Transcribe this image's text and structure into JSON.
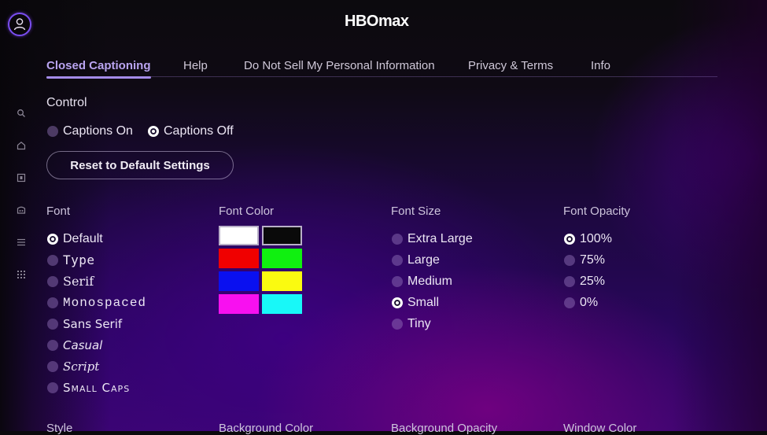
{
  "header": {
    "logo": "HBOmax",
    "profile_icon": "profile-icon"
  },
  "sidebar": {
    "icons": [
      "search-icon",
      "home-icon",
      "watchlist-icon",
      "kids-icon",
      "menu-icon",
      "grid-icon"
    ]
  },
  "tabs": [
    {
      "label": "Closed Captioning",
      "active": true
    },
    {
      "label": "Help",
      "active": false
    },
    {
      "label": "Do Not Sell My Personal Information",
      "active": false
    },
    {
      "label": "Privacy & Terms",
      "active": false
    },
    {
      "label": "Info",
      "active": false
    }
  ],
  "control": {
    "title": "Control",
    "options": [
      {
        "label": "Captions On",
        "selected": false
      },
      {
        "label": "Captions Off",
        "selected": true
      }
    ],
    "reset_label": "Reset to Default Settings"
  },
  "font": {
    "title": "Font",
    "options": [
      {
        "label": "Default",
        "selected": true
      },
      {
        "label": "Type",
        "selected": false
      },
      {
        "label": "Serif",
        "selected": false
      },
      {
        "label": "Monospaced",
        "selected": false
      },
      {
        "label": "Sans Serif",
        "selected": false
      },
      {
        "label": "Casual",
        "selected": false
      },
      {
        "label": "Script",
        "selected": false
      },
      {
        "label": "Small Caps",
        "selected": false
      }
    ]
  },
  "font_color": {
    "title": "Font Color",
    "swatches": [
      {
        "name": "white",
        "color": "#ffffff",
        "selected": true
      },
      {
        "name": "black",
        "color": "#0a0a0a",
        "selected": true
      },
      {
        "name": "red",
        "color": "#f00000",
        "selected": false
      },
      {
        "name": "green",
        "color": "#10f010",
        "selected": false
      },
      {
        "name": "blue",
        "color": "#0a10f0",
        "selected": false
      },
      {
        "name": "yellow",
        "color": "#fafa10",
        "selected": false
      },
      {
        "name": "magenta",
        "color": "#f810f0",
        "selected": false
      },
      {
        "name": "cyan",
        "color": "#18f8f8",
        "selected": false
      }
    ]
  },
  "font_size": {
    "title": "Font Size",
    "options": [
      {
        "label": "Extra Large",
        "selected": false
      },
      {
        "label": "Large",
        "selected": false
      },
      {
        "label": "Medium",
        "selected": false
      },
      {
        "label": "Small",
        "selected": true
      },
      {
        "label": "Tiny",
        "selected": false
      }
    ]
  },
  "font_opacity": {
    "title": "Font Opacity",
    "options": [
      {
        "label": "100%",
        "selected": true
      },
      {
        "label": "75%",
        "selected": false
      },
      {
        "label": "25%",
        "selected": false
      },
      {
        "label": "0%",
        "selected": false
      }
    ]
  },
  "bottom_sections": [
    "Style",
    "Background Color",
    "Background Opacity",
    "Window Color"
  ],
  "colors": {
    "accent": "#a48be8",
    "avatar_ring": "#7a4ef0"
  }
}
